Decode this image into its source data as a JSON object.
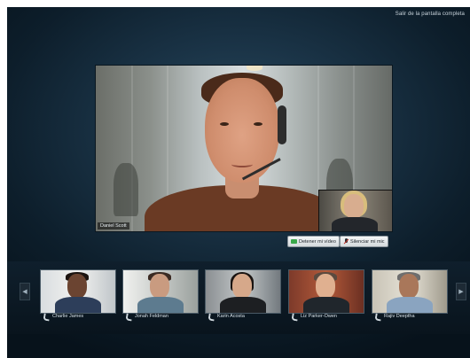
{
  "header": {
    "exit_fullscreen": "Salir de la pantalla completa"
  },
  "main_video": {
    "speaker_name": "Daniel Scott"
  },
  "controls": {
    "stop_video": "Detener mi vídeo",
    "mute_mic": "Silenciar mi mic"
  },
  "participants": [
    {
      "name": "Charlie James"
    },
    {
      "name": "Jonah Feldman"
    },
    {
      "name": "Karin Acosta"
    },
    {
      "name": "Liz Parker-Owen"
    },
    {
      "name": "Rajiv Deeptha"
    }
  ],
  "icons": {
    "exit": "exit-fullscreen-text",
    "video": "camera-icon",
    "mic": "mic-muted-icon",
    "phone": "phone-icon",
    "prev": "chevron-left-icon",
    "next": "chevron-right-icon"
  },
  "colors": {
    "background": "#0d1e2b",
    "video_button_icon": "#3aa84a",
    "mute_slash": "#c2322a"
  }
}
